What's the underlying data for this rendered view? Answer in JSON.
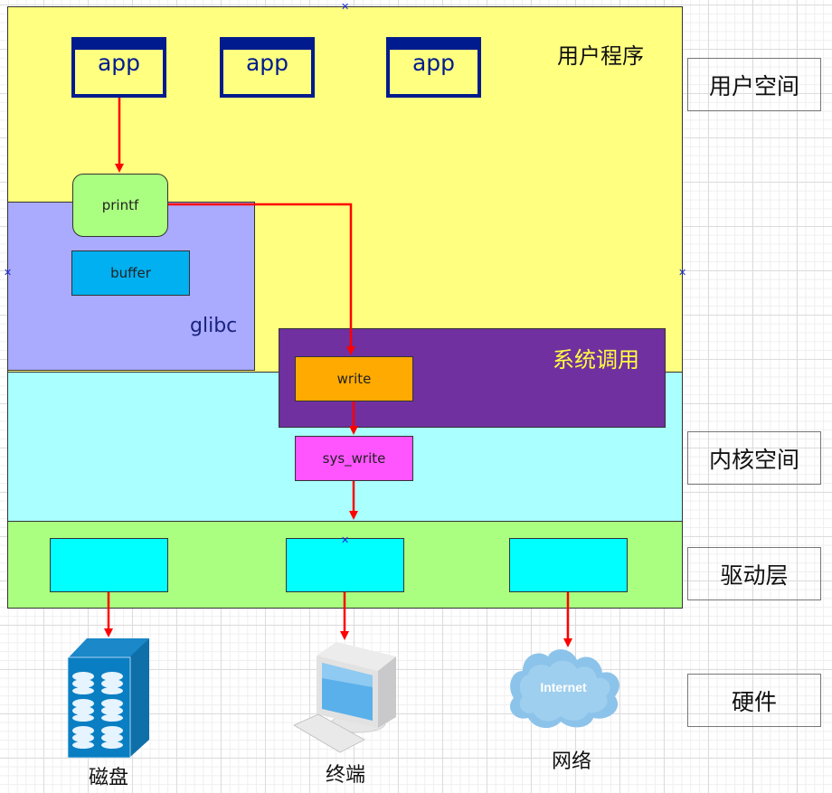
{
  "diagram": {
    "regions": {
      "user_program": {
        "title": "用户程序",
        "fill": "#ffff80"
      },
      "glibc": {
        "title": "glibc",
        "fill": "#aaaaff"
      },
      "kernel": {
        "fill": "#aaffff"
      },
      "syscall": {
        "title": "系统调用",
        "fill": "#7030a0",
        "title_color": "#ffff40"
      },
      "driver": {
        "fill": "#aaff80"
      }
    },
    "apps": [
      {
        "label": "app"
      },
      {
        "label": "app"
      },
      {
        "label": "app"
      }
    ],
    "nodes": {
      "printf": {
        "label": "printf",
        "fill": "#aaff80"
      },
      "buffer": {
        "label": "buffer",
        "fill": "#00b0f0"
      },
      "write": {
        "label": "write",
        "fill": "#ffaa00"
      },
      "sys_write": {
        "label": "sys_write",
        "fill": "#ff55ff"
      }
    },
    "drivers": [
      {
        "label": ""
      },
      {
        "label": ""
      },
      {
        "label": ""
      }
    ],
    "hardware": [
      {
        "label": "磁盘",
        "icon": "disk-storage-icon"
      },
      {
        "label": "终端",
        "icon": "computer-terminal-icon"
      },
      {
        "label": "网络",
        "icon": "internet-cloud-icon",
        "icon_text": "Internet"
      }
    ],
    "layers": [
      {
        "label": "用户空间"
      },
      {
        "label": "内核空间"
      },
      {
        "label": "驱动层"
      },
      {
        "label": "硬件"
      }
    ],
    "arrow_color": "#ff0000"
  }
}
